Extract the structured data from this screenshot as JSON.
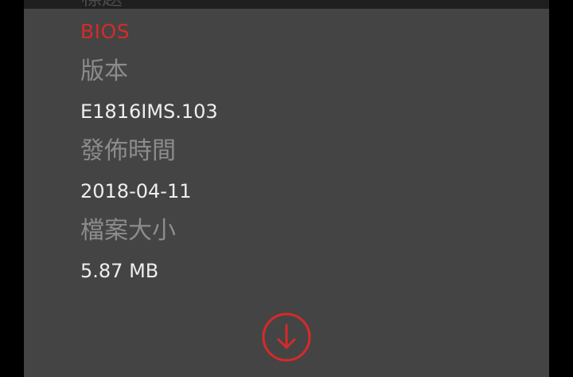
{
  "top_panel": {
    "label": "標題"
  },
  "item": {
    "category": "BIOS",
    "version_label": "版本",
    "version_value": "E1816IMS.103",
    "release_label": "發佈時間",
    "release_value": "2018-04-11",
    "size_label": "檔案大小",
    "size_value": "5.87 MB"
  },
  "icons": {
    "download": "download-arrow-circle-icon"
  },
  "colors": {
    "accent": "#d62a2a",
    "card_bg": "#444444",
    "label": "#8c8c8c",
    "value": "#eeeeee"
  }
}
